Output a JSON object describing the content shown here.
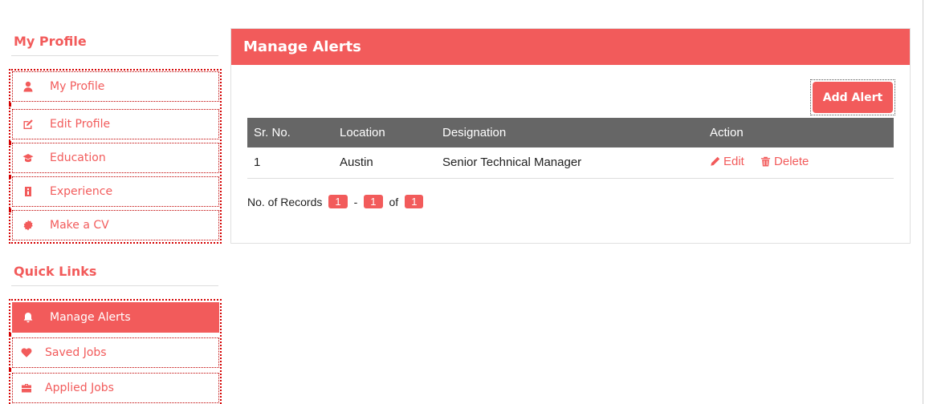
{
  "sidebar": {
    "profile_heading": "My Profile",
    "profile_items": [
      {
        "label": "My Profile",
        "icon": "user-icon"
      },
      {
        "label": "Edit Profile",
        "icon": "edit-icon"
      },
      {
        "label": "Education",
        "icon": "graduation-cap-icon"
      },
      {
        "label": "Experience",
        "icon": "briefcase-badge-icon"
      },
      {
        "label": "Make a CV",
        "icon": "certificate-icon"
      }
    ],
    "links_heading": "Quick Links",
    "link_items": [
      {
        "label": "Manage Alerts",
        "icon": "bell-icon",
        "active": true
      },
      {
        "label": "Saved Jobs",
        "icon": "heart-icon"
      },
      {
        "label": "Applied Jobs",
        "icon": "briefcase-icon"
      }
    ]
  },
  "main": {
    "title": "Manage Alerts",
    "add_button": "Add Alert",
    "table": {
      "headers": [
        "Sr. No.",
        "Location",
        "Designation",
        "Action"
      ],
      "rows": [
        {
          "sr": "1",
          "location": "Austin",
          "designation": "Senior Technical Manager",
          "edit": "Edit",
          "delete": "Delete"
        }
      ]
    },
    "records": {
      "label": "No. of Records",
      "from": "1",
      "dash": "-",
      "to": "1",
      "of": "of",
      "total": "1"
    }
  },
  "colors": {
    "accent": "#f25b5b",
    "table_header": "#666666",
    "active_border": "#d40000"
  }
}
